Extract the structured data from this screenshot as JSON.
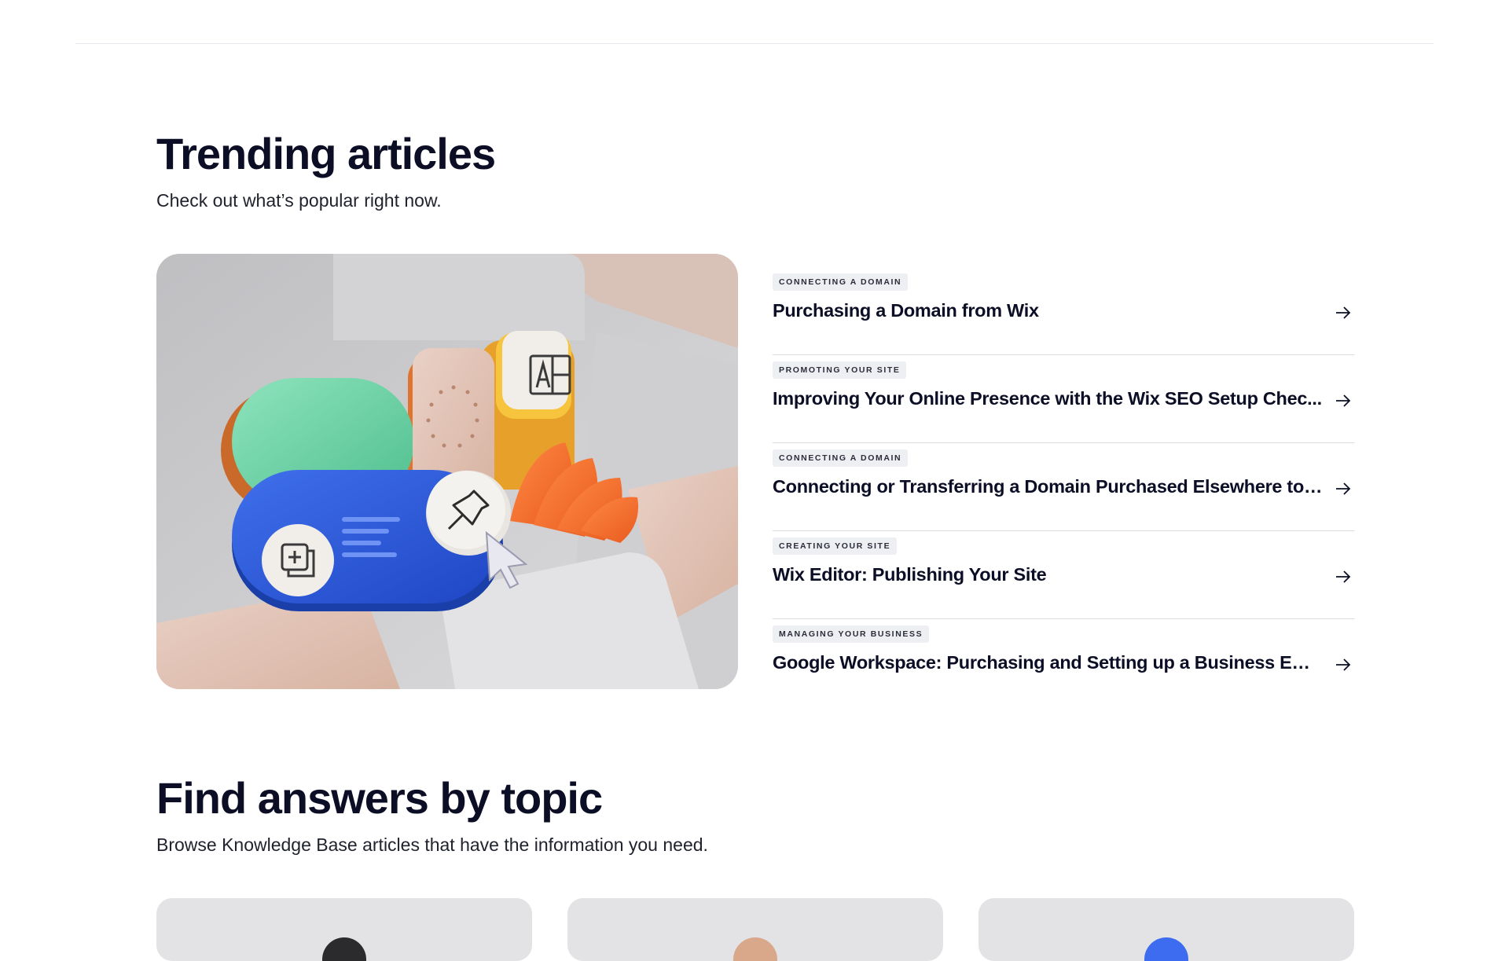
{
  "trending": {
    "title": "Trending articles",
    "subtitle": "Check out what’s popular right now."
  },
  "articles": [
    {
      "tag": "Connecting a Domain",
      "title": "Purchasing a Domain from Wix"
    },
    {
      "tag": "Promoting Your Site",
      "title": "Improving Your Online Presence with the Wix SEO Setup Chec..."
    },
    {
      "tag": "Connecting a Domain",
      "title": "Connecting or Transferring a Domain Purchased Elsewhere to ..."
    },
    {
      "tag": "Creating Your Site",
      "title": "Wix Editor: Publishing Your Site"
    },
    {
      "tag": "Managing Your Business",
      "title": "Google Workspace: Purchasing and Setting up a Business Email"
    }
  ],
  "topics": {
    "title": "Find answers by topic",
    "subtitle": "Browse Knowledge Base articles that have the information you need."
  },
  "icons": {
    "article_arrow": "arrow-right-icon",
    "hero_icons": [
      "add-page-icon",
      "pushpin-icon",
      "text-block-icon",
      "cursor-icon"
    ]
  },
  "colors": {
    "heading": "#0c0e25",
    "tag_bg": "#eeeff3",
    "divider": "#dcdde3",
    "green_tile": "#69d3a6",
    "blue_tile": "#2f59d6",
    "orange_tile": "#f07233",
    "yellow_tile": "#f6c43d"
  }
}
